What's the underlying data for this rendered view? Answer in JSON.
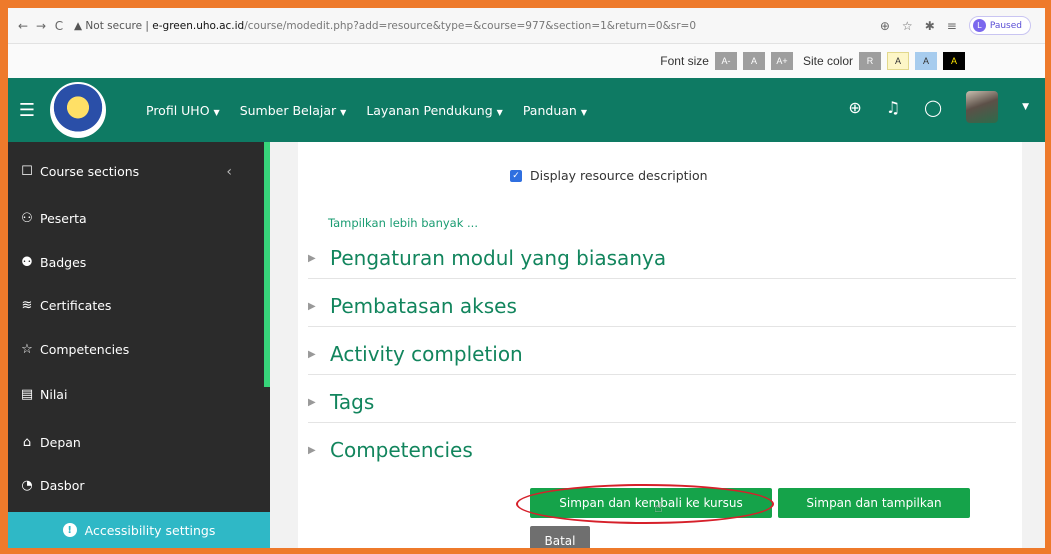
{
  "browser": {
    "back": "←",
    "forward": "→",
    "reload": "C",
    "security": "▲ Not secure |",
    "host": "e-green.uho.ac.id",
    "path": "/course/modedit.php?add=resource&type=&course=977&section=1&return=0&sr=0",
    "paused_label": "Paused",
    "profile_initial": "L"
  },
  "a11y_bar": {
    "font_size_label": "Font size",
    "font_buttons": [
      "A-",
      "A",
      "A+"
    ],
    "site_color_label": "Site color",
    "color_buttons": [
      "R",
      "A",
      "A",
      "A"
    ]
  },
  "navbar": {
    "menu": [
      {
        "label": "Profil UHO"
      },
      {
        "label": "Sumber Belajar"
      },
      {
        "label": "Layanan Pendukung"
      },
      {
        "label": "Panduan"
      }
    ]
  },
  "sidebar": {
    "items": [
      {
        "label": "Course sections",
        "icon": "folder-icon"
      },
      {
        "label": "Peserta",
        "icon": "users-icon"
      },
      {
        "label": "Badges",
        "icon": "badge-icon"
      },
      {
        "label": "Certificates",
        "icon": "certificate-icon"
      },
      {
        "label": "Competencies",
        "icon": "star-icon"
      },
      {
        "label": "Nilai",
        "icon": "grades-icon"
      },
      {
        "label": "Depan",
        "icon": "home-icon"
      },
      {
        "label": "Dasbor",
        "icon": "dashboard-icon"
      }
    ],
    "accessibility_settings": "Accessibility settings"
  },
  "content": {
    "display_description": "Display resource description",
    "show_more": "Tampilkan lebih banyak ...",
    "sections": [
      "Pengaturan modul yang biasanya",
      "Pembatasan akses",
      "Activity completion",
      "Tags",
      "Competencies"
    ],
    "buttons": {
      "save_return": "Simpan dan kembali ke kursus",
      "save_display": "Simpan dan tampilkan",
      "cancel": "Batal"
    }
  },
  "colors": {
    "frame": "#ee7a2b",
    "navbar": "#0e7a63",
    "sidebar": "#2b2b2b",
    "accent": "#12855d",
    "primary_button": "#15a34a",
    "highlight": "#d6202a"
  }
}
